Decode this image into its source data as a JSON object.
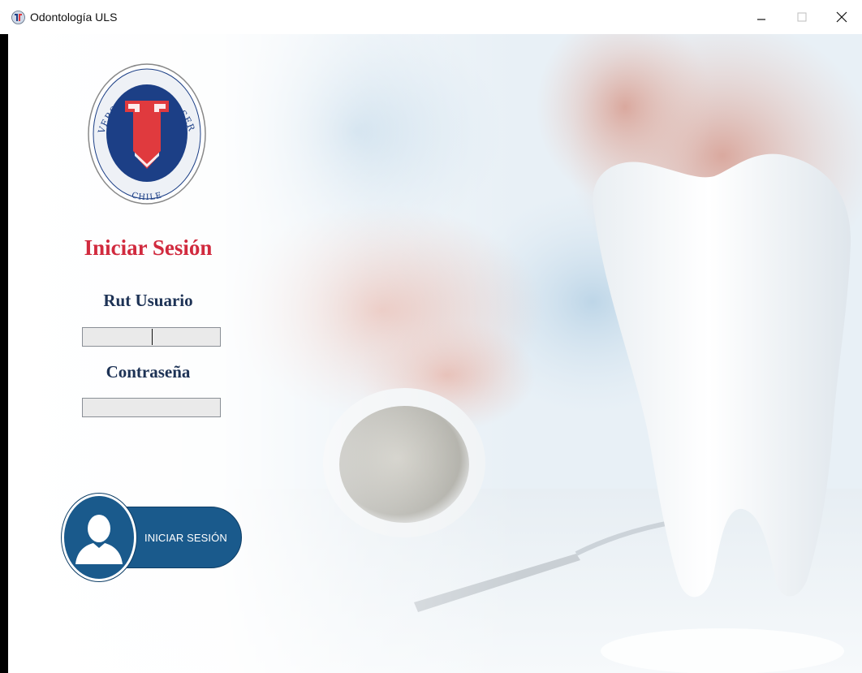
{
  "window": {
    "title": "Odontología ULS",
    "app_icon": "uls-logo-icon",
    "controls": {
      "minimize_icon": "minimize-icon",
      "maximize_icon": "maximize-icon",
      "close_icon": "close-icon"
    }
  },
  "background": {
    "image": "dental-tooth-and-mirror-photo"
  },
  "logo": {
    "arc_text_top": "UNIVERSIDAD DE LA SERENA",
    "arc_text_bottom": "CHILE",
    "monogram": "US",
    "colors": {
      "navy": "#1c3f86",
      "red": "#e03a3e",
      "ring": "#ffffff"
    }
  },
  "login": {
    "title": "Iniciar Sesión",
    "rut_label": "Rut Usuario",
    "rut_value": "",
    "password_label": "Contraseña",
    "password_value": "",
    "button_label": "INICIAR SESIÓN",
    "button_icon": "user-icon"
  },
  "colors": {
    "title_red": "#d12a3e",
    "label_navy": "#1d3255",
    "button_blue": "#1a5a8c"
  }
}
